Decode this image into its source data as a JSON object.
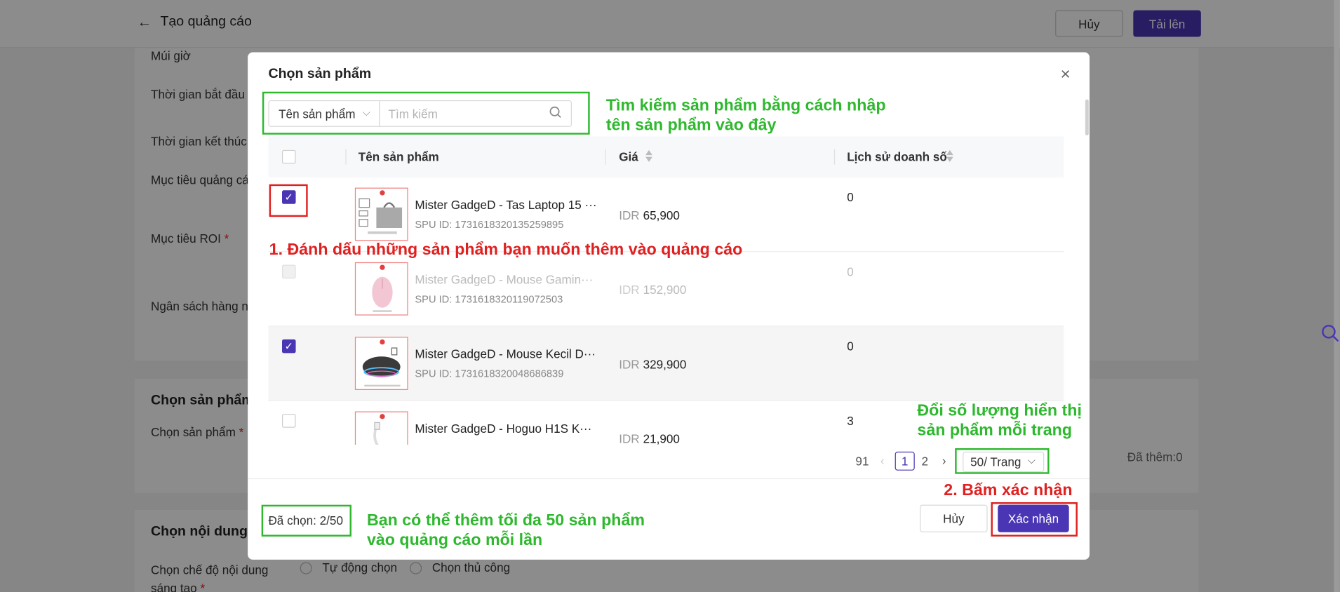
{
  "page": {
    "title": "Tạo quảng cáo",
    "cancel_label": "Hủy",
    "upload_label": "Tải lên",
    "labels": {
      "timezone": "Múi giờ",
      "start_time": "Thời gian bắt đầu",
      "end_time": "Thời gian kết thúc",
      "ad_goal": "Mục tiêu quảng cáo",
      "roi_goal": "Mục tiêu ROI",
      "daily_budget": "Ngân sách hàng ngày"
    },
    "section_products": "Chọn sản phẩm",
    "select_products_label": "Chọn sản phẩm",
    "added_count": "Đã thêm:0",
    "section_content": "Chọn nội dung",
    "creative_mode_label": "Chọn chế độ nội dung sáng tạo",
    "radio_auto": "Tự động chọn",
    "radio_manual": "Chọn thủ công"
  },
  "modal": {
    "title": "Chọn sản phẩm",
    "search_field_select": "Tên sản phẩm",
    "search_placeholder": "Tìm kiếm",
    "columns": {
      "name": "Tên sản phẩm",
      "price": "Giá",
      "sales_history": "Lịch sử doanh số"
    },
    "rows": [
      {
        "name": "Mister GadgeD - Tas Laptop 15 ···",
        "spu": "SPU ID: 1731618320135259895",
        "currency": "IDR",
        "price": "65,900",
        "sales": "0",
        "checked": true,
        "disabled": false
      },
      {
        "name": "Mister GadgeD - Mouse Gamin···",
        "spu": "SPU ID: 1731618320119072503",
        "currency": "IDR",
        "price": "152,900",
        "sales": "0",
        "checked": false,
        "disabled": true
      },
      {
        "name": "Mister GadgeD - Mouse Kecil D···",
        "spu": "SPU ID: 1731618320048686839",
        "currency": "IDR",
        "price": "329,900",
        "sales": "0",
        "checked": true,
        "disabled": false
      },
      {
        "name": "Mister GadgeD - Hoguo H1S K···",
        "spu": "",
        "currency": "IDR",
        "price": "21,900",
        "sales": "3",
        "checked": false,
        "disabled": false
      }
    ],
    "pagination": {
      "total": "91",
      "pages": [
        "1",
        "2"
      ],
      "current": "1",
      "page_size": "50/ Trang"
    },
    "selected_count": "Đã chọn: 2/50",
    "cancel_label": "Hủy",
    "confirm_label": "Xác nhận"
  },
  "annotations": {
    "search_tip_line1": "Tìm kiếm sản phẩm bằng cách nhập",
    "search_tip_line2": "tên sản phẩm vào đây",
    "step1": "1. Đánh dấu những sản phẩm bạn muốn thêm vào quảng cáo",
    "page_size_tip_line1": "Đổi số lượng hiển thị",
    "page_size_tip_line2": "sản phẩm mỗi trang",
    "step2": "2. Bấm xác nhận",
    "limit_tip_line1": "Bạn có thể thêm tối đa 50 sản phẩm",
    "limit_tip_line2": "vào quảng cáo mỗi lần"
  },
  "colors": {
    "primary": "#4a35b4",
    "annotation_green": "#2eb82e",
    "annotation_red": "#e02020"
  }
}
